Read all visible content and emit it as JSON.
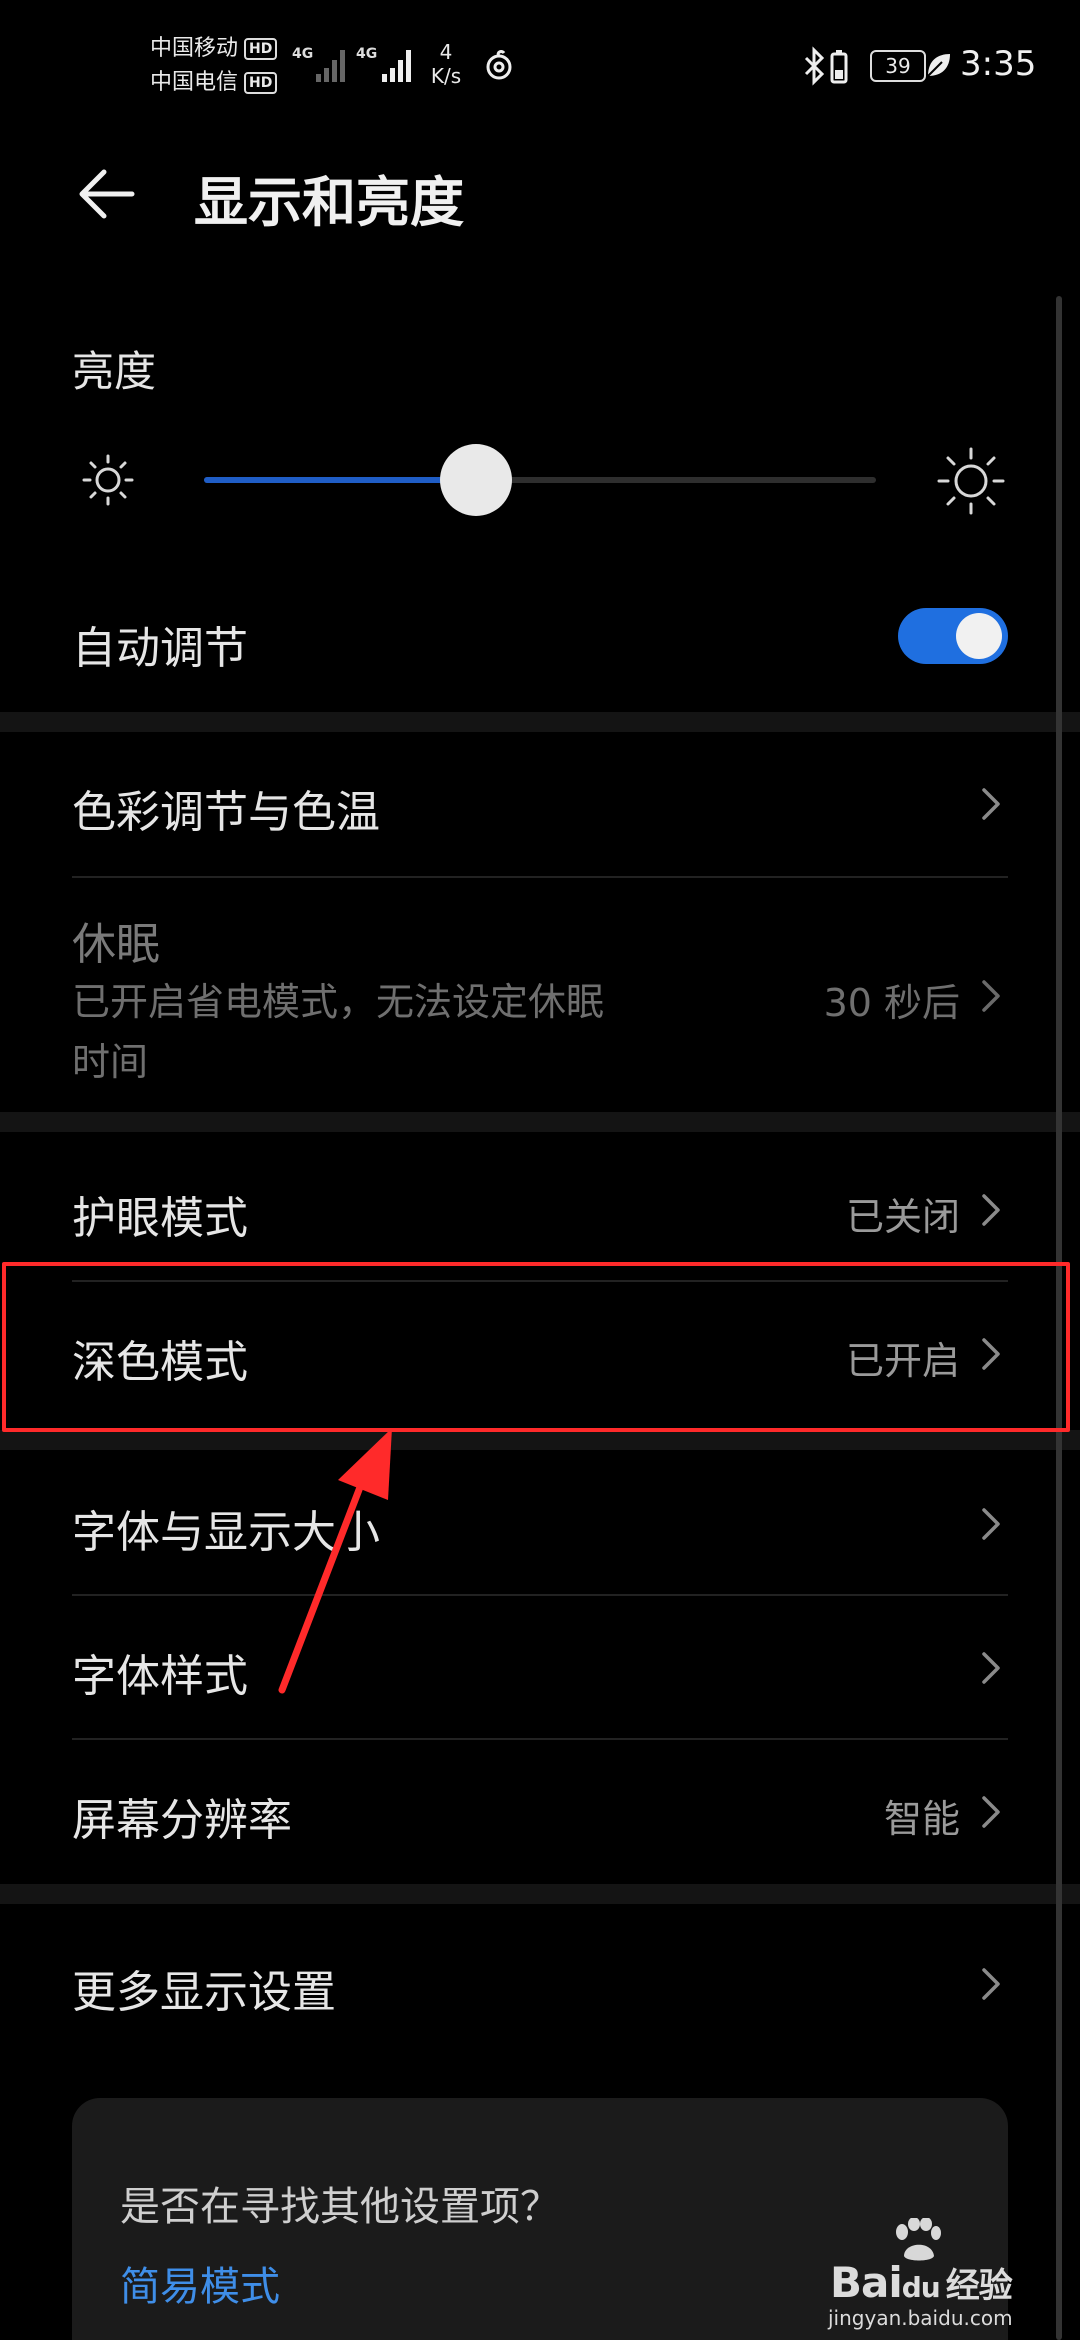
{
  "status_bar": {
    "carrier1": "中国移动",
    "carrier2": "中国电信",
    "hd_badge": "HD",
    "sig1_label": "4G",
    "sig2_label": "4G",
    "net_speed_value": "4",
    "net_speed_unit": "K/s",
    "battery": "39",
    "time": "3:35"
  },
  "header": {
    "title": "显示和亮度"
  },
  "brightness": {
    "label": "亮度",
    "level": 0.405,
    "auto_label": "自动调节",
    "auto_enabled": true
  },
  "rows": {
    "color_temp": {
      "title": "色彩调节与色温"
    },
    "sleep": {
      "title": "休眠",
      "subtitle_line1": "已开启省电模式，无法设定休眠",
      "subtitle_line2": "时间",
      "value": "30 秒后"
    },
    "eye_comfort": {
      "title": "护眼模式",
      "value": "已关闭"
    },
    "dark_mode": {
      "title": "深色模式",
      "value": "已开启"
    },
    "font_size": {
      "title": "字体与显示大小"
    },
    "font_style": {
      "title": "字体样式"
    },
    "resolution": {
      "title": "屏幕分辨率",
      "value": "智能"
    },
    "more_display": {
      "title": "更多显示设置"
    }
  },
  "suggestion": {
    "question": "是否在寻找其他设置项？",
    "link": "简易模式"
  },
  "watermark": {
    "brand": "Bai",
    "brand2": "du",
    "brand_cn": "经验",
    "url": "jingyan.baidu.com"
  },
  "colors": {
    "accent": "#1f6fe0",
    "highlight": "#ff2a2a",
    "link": "#3f8ee8"
  }
}
